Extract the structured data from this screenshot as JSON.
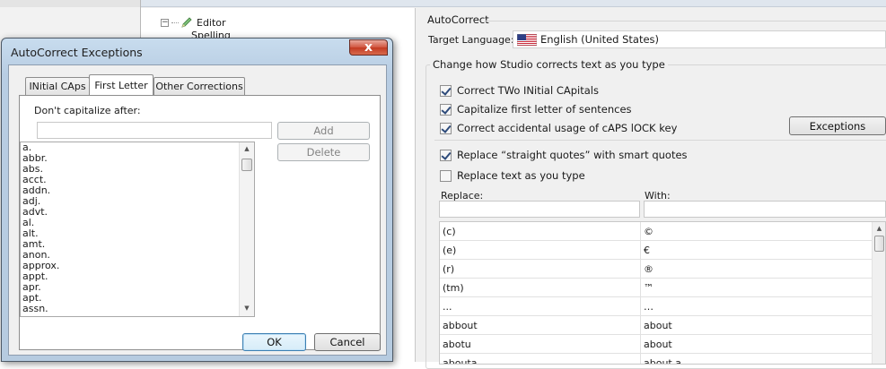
{
  "tree": {
    "items": [
      {
        "label": "Editor",
        "expander": "−"
      },
      {
        "label": "Spelling"
      }
    ]
  },
  "options": {
    "section_title": "AutoCorrect",
    "target_language_label": "Target Language:",
    "target_language_value": "English (United States)",
    "change_group_label": "Change how Studio corrects text as you type",
    "checkboxes": [
      {
        "label": "Correct TWo INitial CApitals",
        "checked": true
      },
      {
        "label": "Capitalize first letter of sentences",
        "checked": true
      },
      {
        "label": "Correct accidental usage of cAPS lOCK key",
        "checked": true
      },
      {
        "label": "Replace “straight quotes” with smart quotes",
        "checked": true
      },
      {
        "label": "Replace text as you type",
        "checked": false
      }
    ],
    "exceptions_button": "Exceptions",
    "replace_label": "Replace:",
    "with_label": "With:",
    "replace_value": "",
    "with_value": "",
    "table": [
      {
        "replace": "(c)",
        "with": "©"
      },
      {
        "replace": "(e)",
        "with": "€"
      },
      {
        "replace": "(r)",
        "with": "®"
      },
      {
        "replace": "(tm)",
        "with": "™"
      },
      {
        "replace": "...",
        "with": "…"
      },
      {
        "replace": "abbout",
        "with": "about"
      },
      {
        "replace": "abotu",
        "with": "about"
      },
      {
        "replace": "abouta",
        "with": "about a"
      }
    ]
  },
  "dialog": {
    "title": "AutoCorrect Exceptions",
    "close_label": "x",
    "tabs": [
      {
        "label": "INitial CAps",
        "active": false
      },
      {
        "label": "First Letter",
        "active": true
      },
      {
        "label": "Other Corrections",
        "active": false
      }
    ],
    "dont_capitalize_label": "Don't capitalize after:",
    "entry_value": "",
    "add_button": "Add",
    "delete_button": "Delete",
    "words": [
      "a.",
      "abbr.",
      "abs.",
      "acct.",
      "addn.",
      "adj.",
      "advt.",
      "al.",
      "alt.",
      "amt.",
      "anon.",
      "approx.",
      "appt.",
      "apr.",
      "apt.",
      "assn."
    ],
    "ok_button": "OK",
    "cancel_button": "Cancel"
  },
  "colors": {
    "dialog_frame": "#b8cde3",
    "close_button": "#c23a22",
    "focus_border": "#3c7fb1"
  }
}
